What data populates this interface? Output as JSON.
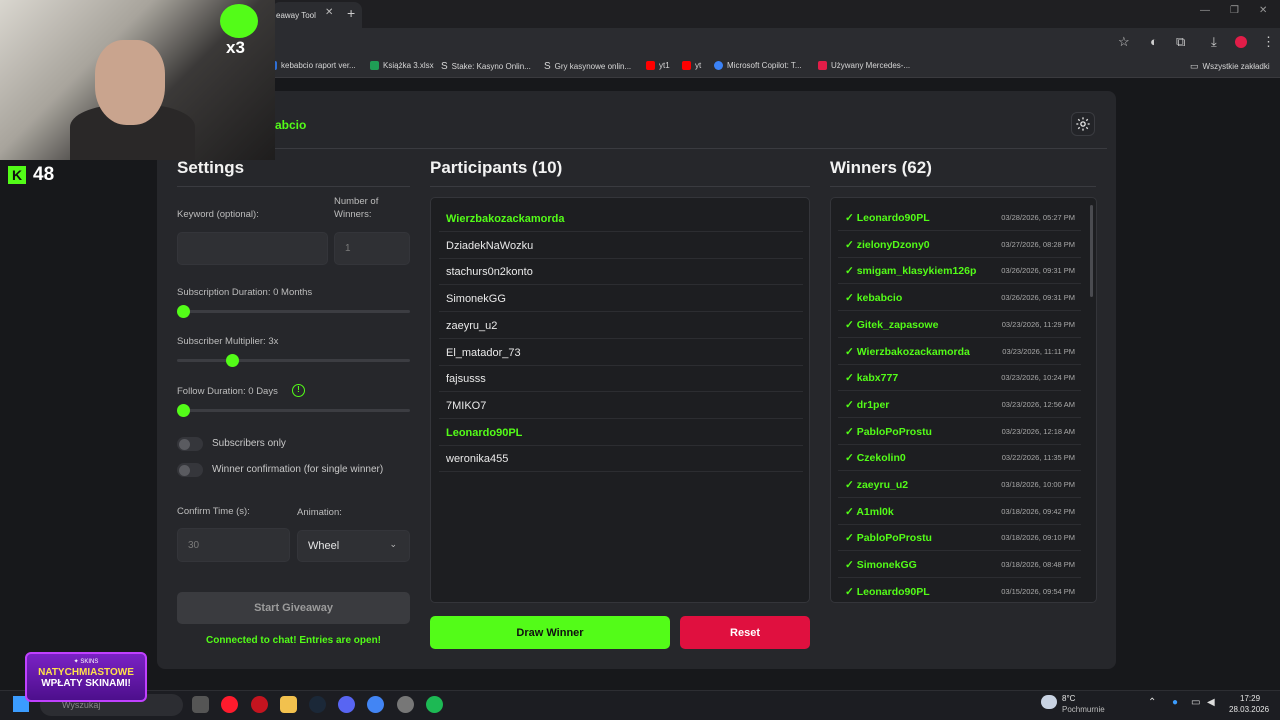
{
  "browser": {
    "tab_title": "eaway Tool",
    "tab_close": "✕",
    "new_tab": "+",
    "bookmarks": [
      {
        "label": "kebabcio raport ver...",
        "color": "#2f6fd6"
      },
      {
        "label": "Książka 3.xlsx",
        "color": "#1f9d55"
      },
      {
        "label": "Stake: Kasyno Onlin...",
        "color": "#dddddd"
      },
      {
        "label": "Gry kasynowe onlin...",
        "color": "#dddddd"
      },
      {
        "label": "yt1",
        "color": "#ff0000"
      },
      {
        "label": "yt",
        "color": "#ff0000"
      },
      {
        "label": "Microsoft Copilot: T...",
        "color": "#3b82f6"
      },
      {
        "label": "Używany Mercedes-...",
        "color": "#e11d48"
      }
    ],
    "all_bookmarks": "Wszystkie zakładki"
  },
  "app": {
    "name": "abcio",
    "settings": {
      "title": "Settings",
      "keyword_label": "Keyword (optional):",
      "keyword_value": "",
      "winners_label_1": "Number of",
      "winners_label_2": "Winners:",
      "winners_placeholder": "1",
      "sub_duration_label": "Subscription Duration: 0 Months",
      "sub_duration_level": 0,
      "multiplier_label": "Subscriber Multiplier: 3x",
      "multiplier_level": 0.24,
      "follow_label": "Follow Duration:  0  Days",
      "follow_info_icon": "info-icon",
      "follow_level": 0,
      "subs_only_label": "Subscribers only",
      "subs_only_on": false,
      "confirm_label": "Winner confirmation (for single winner)",
      "confirm_on": false,
      "confirm_time_label": "Confirm Time (s):",
      "confirm_time_placeholder": "30",
      "animation_label": "Animation:",
      "animation_value": "Wheel",
      "start_button": "Start Giveaway",
      "status": "Connected to chat! Entries are open!"
    },
    "participants": {
      "title": "Participants (10)",
      "items": [
        {
          "name": "Wierzbakozackamorda",
          "highlight": true
        },
        {
          "name": "DziadekNaWozku",
          "highlight": false
        },
        {
          "name": "stachurs0n2konto",
          "highlight": false
        },
        {
          "name": "SimonekGG",
          "highlight": false
        },
        {
          "name": "zaeyru_u2",
          "highlight": false
        },
        {
          "name": "El_matador_73",
          "highlight": false
        },
        {
          "name": "fajsusss",
          "highlight": false
        },
        {
          "name": "7MIKO7",
          "highlight": false
        },
        {
          "name": "Leonardo90PL",
          "highlight": true
        },
        {
          "name": "weronika455",
          "highlight": false
        }
      ],
      "draw_button": "Draw Winner",
      "reset_button": "Reset"
    },
    "winners": {
      "title": "Winners (62)",
      "items": [
        {
          "name": "✓ Leonardo90PL",
          "date": "03/28/2026, 05:27 PM"
        },
        {
          "name": "✓ zielonyDzony0",
          "date": "03/27/2026, 08:28 PM"
        },
        {
          "name": "✓ smigam_klasykiem126p",
          "date": "03/26/2026, 09:31 PM"
        },
        {
          "name": "✓ kebabcio",
          "date": "03/26/2026, 09:31 PM"
        },
        {
          "name": "✓ Gitek_zapasowe",
          "date": "03/23/2026, 11:29 PM"
        },
        {
          "name": "✓ Wierzbakozackamorda",
          "date": "03/23/2026, 11:11 PM"
        },
        {
          "name": "✓ kabx777",
          "date": "03/23/2026, 10:24 PM"
        },
        {
          "name": "✓ dr1per",
          "date": "03/23/2026, 12:56 AM"
        },
        {
          "name": "✓ PabloPoProstu",
          "date": "03/23/2026, 12:18 AM"
        },
        {
          "name": "✓ Czekolin0",
          "date": "03/22/2026, 11:35 PM"
        },
        {
          "name": "✓ zaeyru_u2",
          "date": "03/18/2026, 10:00 PM"
        },
        {
          "name": "✓ A1ml0k",
          "date": "03/18/2026, 09:42 PM"
        },
        {
          "name": "✓ PabloPoProstu",
          "date": "03/18/2026, 09:10 PM"
        },
        {
          "name": "✓ SimonekGG",
          "date": "03/18/2026, 08:48 PM"
        },
        {
          "name": "✓ Leonardo90PL",
          "date": "03/15/2026, 09:54 PM"
        }
      ]
    },
    "accent": "#53fc18",
    "danger": "#e0103f"
  },
  "overlay": {
    "emote_multiplier": "x3",
    "kick_badge": "K",
    "kick_count": "48",
    "promo_brand": "✦ SKINS",
    "promo_line1": "NATYCHMIASTOWE",
    "promo_line2": "WPŁATY SKINAMI!"
  },
  "taskbar": {
    "search_placeholder": "Wyszukaj",
    "weather_temp": "8°C",
    "weather_desc": "Pochmurnie",
    "time": "17:29",
    "date": "28.03.2026"
  }
}
